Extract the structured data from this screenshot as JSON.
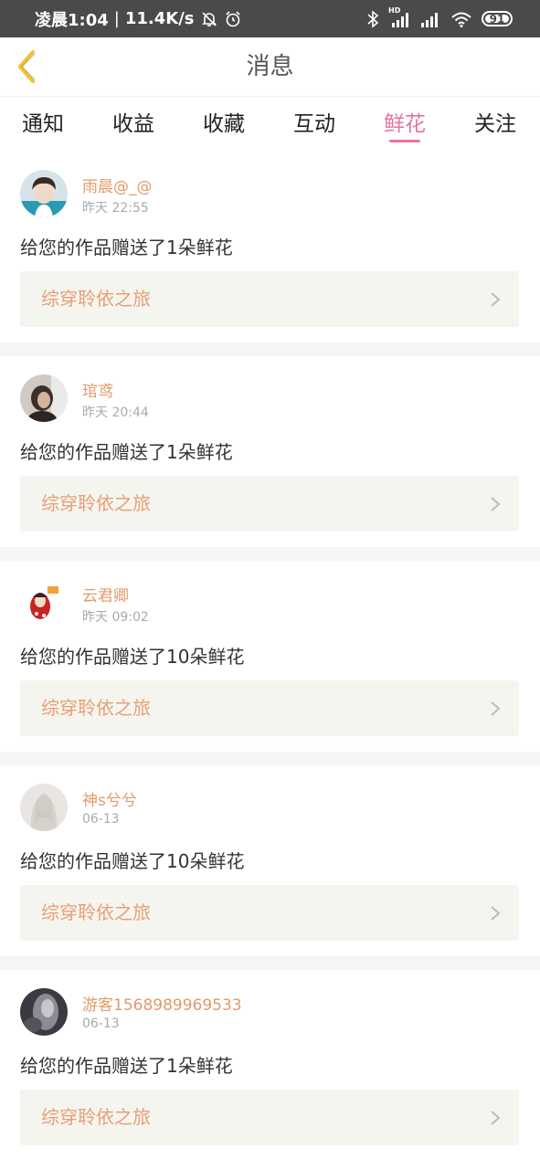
{
  "status_bar": {
    "time": "凌晨1:04",
    "speed": "11.4K/s",
    "hd": "HD",
    "battery": "91"
  },
  "header": {
    "title": "消息"
  },
  "tabs": [
    {
      "label": "通知"
    },
    {
      "label": "收益"
    },
    {
      "label": "收藏"
    },
    {
      "label": "互动"
    },
    {
      "label": "鲜花",
      "active": true
    },
    {
      "label": "关注"
    }
  ],
  "colors": {
    "accent": "#e8739c",
    "username": "#e3996b",
    "work_title": "#e89f78",
    "card_bg": "#f5f5ef"
  },
  "items": [
    {
      "username": "雨晨@_@",
      "time": "昨天 22:55",
      "message": "给您的作品赠送了1朵鲜花",
      "work": "综穿聆依之旅"
    },
    {
      "username": "琯鸢",
      "time": "昨天 20:44",
      "message": "给您的作品赠送了1朵鲜花",
      "work": "综穿聆依之旅"
    },
    {
      "username": "云君卿",
      "time": "昨天 09:02",
      "message": "给您的作品赠送了10朵鲜花",
      "work": "综穿聆依之旅"
    },
    {
      "username": "神s兮兮",
      "time": "06-13",
      "message": "给您的作品赠送了10朵鲜花",
      "work": "综穿聆依之旅"
    },
    {
      "username": "游客1568989969533",
      "time": "06-13",
      "message": "给您的作品赠送了1朵鲜花",
      "work": "综穿聆依之旅"
    }
  ]
}
